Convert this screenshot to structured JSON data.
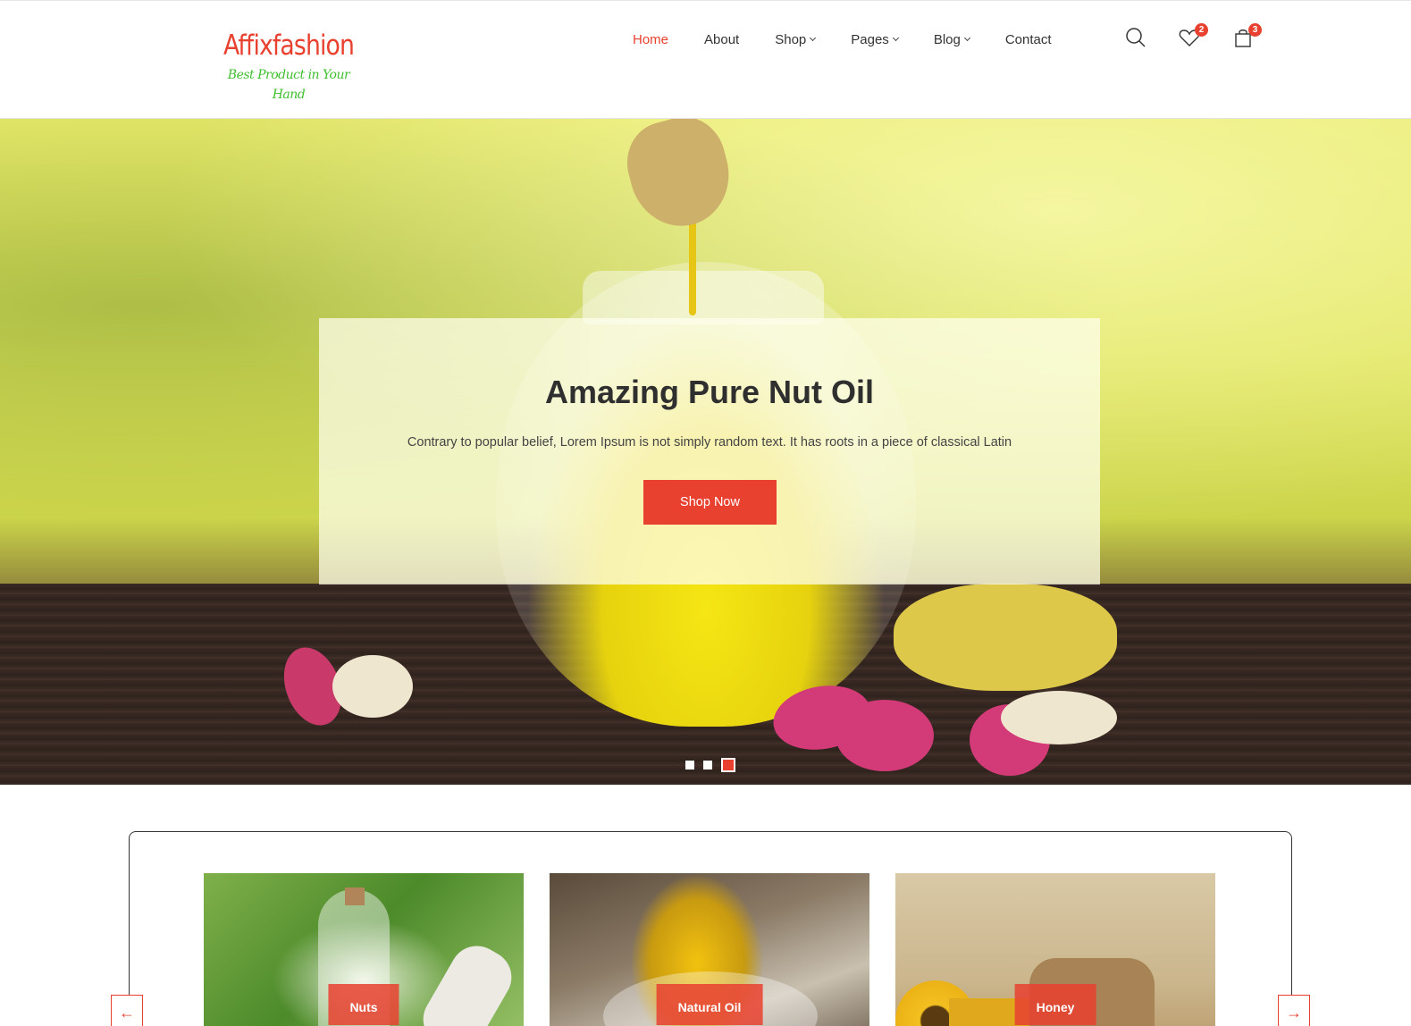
{
  "brand": {
    "name": "Affixfashion",
    "tagline": "Best Product in Your Hand"
  },
  "nav": {
    "items": [
      {
        "label": "Home",
        "active": true
      },
      {
        "label": "About"
      },
      {
        "label": "Shop",
        "dropdown": true
      },
      {
        "label": "Pages",
        "dropdown": true
      },
      {
        "label": "Blog",
        "dropdown": true
      },
      {
        "label": "Contact"
      }
    ]
  },
  "header_icons": {
    "wishlist_count": "2",
    "cart_count": "3"
  },
  "hero": {
    "title": "Amazing Pure Nut Oil",
    "description": "Contrary to popular belief, Lorem Ipsum is not simply random text. It has roots in a piece of classical Latin",
    "button": "Shop Now",
    "slides": 3,
    "active_slide": 3
  },
  "categories": [
    {
      "label": "Nuts"
    },
    {
      "label": "Natural Oil"
    },
    {
      "label": "Honey"
    }
  ],
  "colors": {
    "accent": "#e8412f",
    "tagline": "#3fbf2f",
    "text": "#333333"
  }
}
